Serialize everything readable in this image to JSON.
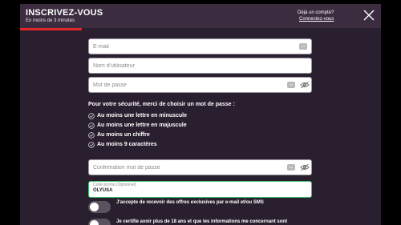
{
  "header": {
    "title": "INSCRIVEZ-VOUS",
    "subtitle": "En moins de 3 minutes",
    "account_question": "Déjà un compte?",
    "connect_label": "Connectez-vous",
    "progress_fraction": 0.17
  },
  "form": {
    "email": {
      "placeholder": "E-mail",
      "value": ""
    },
    "username": {
      "placeholder": "Nom d'utilisateur",
      "value": ""
    },
    "password": {
      "placeholder": "Mot de passe",
      "value": ""
    },
    "confirm": {
      "placeholder": "Confirmation mot de passe",
      "value": ""
    },
    "promo": {
      "label": "Code promo (Optionnel)",
      "value": "OLYUSA"
    },
    "key_badge": "•••"
  },
  "rules": {
    "title": "Pour votre sécurité, merci de choisir un mot de passe :",
    "items": [
      "Au moins une lettre en minuscule",
      "Au moins une lettre en majuscule",
      "Au moins un chiffre",
      "Au moins 9 caractères"
    ]
  },
  "consents": {
    "offers_label": "J'accepte de recevoir des offres exclusives par e-mail et/ou SMS",
    "age_label": "Je certifie avoir plus de 18 ans et que les informations me concernant sont"
  },
  "colors": {
    "accent": "#e2262a",
    "modal_bg": "#2a1f2e",
    "header_bg": "#3b2c40",
    "valid_border": "#3cc46b"
  }
}
